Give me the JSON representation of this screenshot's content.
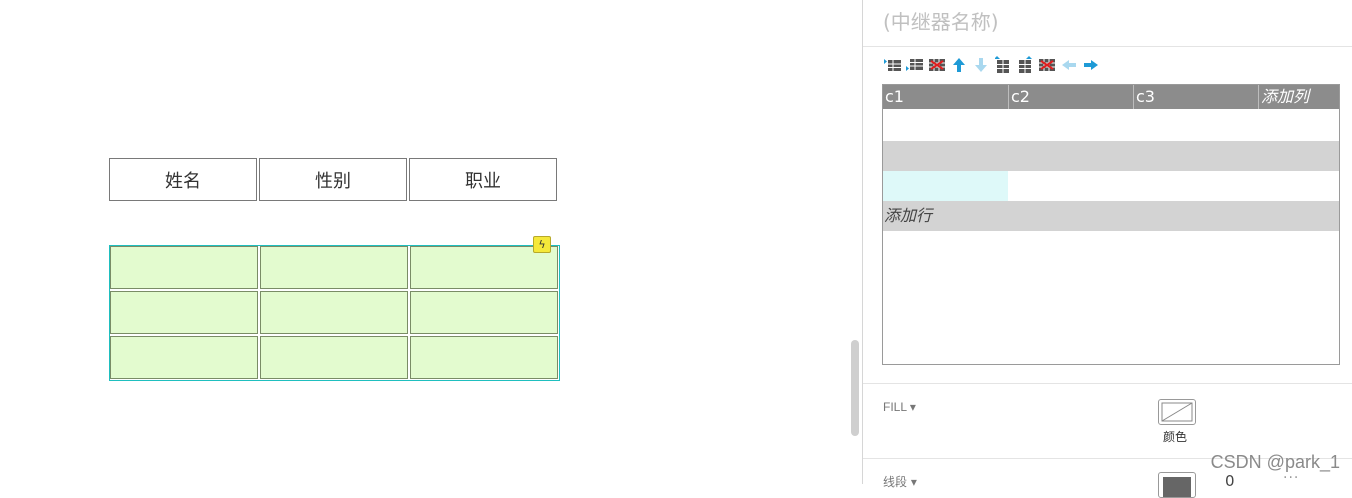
{
  "canvas": {
    "header_table": [
      "姓名",
      "性别",
      "职业"
    ],
    "repeater_rows": 3,
    "repeater_cols": 3,
    "repeater_fill_color": "#e3fbcf",
    "repeater_border_color": "#1fbfbf"
  },
  "panel": {
    "repeater_name_placeholder": "(中继器名称)",
    "toolbar_icons": [
      "insert-row-above-icon",
      "insert-row-below-icon",
      "delete-row-icon",
      "move-up-icon",
      "move-down-icon",
      "insert-column-left-icon",
      "insert-column-right-icon",
      "delete-column-icon",
      "move-left-icon",
      "move-right-icon"
    ],
    "grid": {
      "columns": [
        "c1",
        "c2",
        "c3"
      ],
      "add_column_label": "添加列",
      "add_row_label": "添加行"
    },
    "fill": {
      "label": "FILL",
      "dropdown_glyph": "▾",
      "color_caption": "颜色"
    },
    "stroke": {
      "label": "线段",
      "dropdown_glyph": "▾",
      "value": "0"
    }
  },
  "watermark": "CSDN @park_1",
  "colors": {
    "accent_blue": "#1e9ad6",
    "grid_header": "#8c8c8c",
    "row_gray": "#d3d3d3",
    "selected_cell": "#def9f9"
  }
}
